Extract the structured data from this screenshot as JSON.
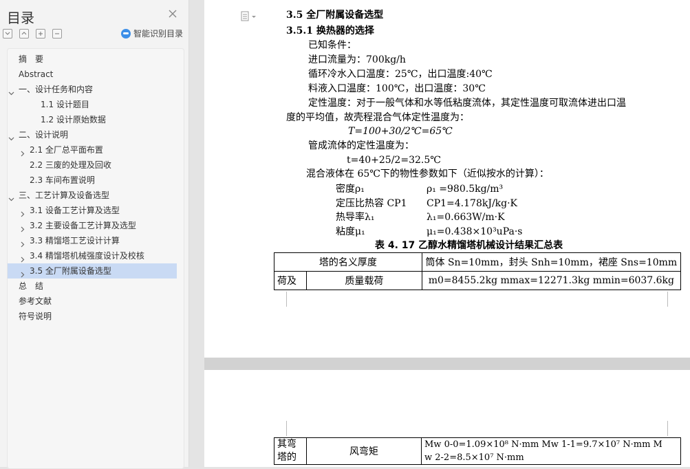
{
  "sidebar": {
    "title": "目录",
    "smart_toc_label": "智能识别目录",
    "items": [
      {
        "label": "摘　要",
        "level": 0,
        "chevron": "none"
      },
      {
        "label": "Abstract",
        "level": 0,
        "chevron": "none"
      },
      {
        "label": "一、设计任务和内容",
        "level": 0,
        "chevron": "down"
      },
      {
        "label": "1.1  设计题目",
        "level": 2,
        "chevron": "none"
      },
      {
        "label": "1.2  设计原始数据",
        "level": 2,
        "chevron": "none"
      },
      {
        "label": "二、设计说明",
        "level": 0,
        "chevron": "down"
      },
      {
        "label": "2.1  全厂总平面布置",
        "level": 1,
        "chevron": "right"
      },
      {
        "label": "2.2  三废的处理及回收",
        "level": 1,
        "chevron": "none"
      },
      {
        "label": "2.3  车间布置说明",
        "level": 1,
        "chevron": "none"
      },
      {
        "label": "三、工艺计算及设备选型",
        "level": 0,
        "chevron": "down"
      },
      {
        "label": "3.1  设备工艺计算及选型",
        "level": 1,
        "chevron": "right"
      },
      {
        "label": "3.2  主要设备工艺计算及选型",
        "level": 1,
        "chevron": "right"
      },
      {
        "label": "3.3  精馏塔工艺设计计算",
        "level": 1,
        "chevron": "right"
      },
      {
        "label": "3.4  精馏塔机械强度设计及校核",
        "level": 1,
        "chevron": "right"
      },
      {
        "label": "3.5  全厂附属设备选型",
        "level": 1,
        "chevron": "right",
        "active": true
      },
      {
        "label": "总　结",
        "level": 0,
        "chevron": "none"
      },
      {
        "label": "参考文献",
        "level": 0,
        "chevron": "none"
      },
      {
        "label": "符号说明",
        "level": 0,
        "chevron": "none"
      }
    ]
  },
  "doc": {
    "h1": "3.5  全厂附属设备选型",
    "h2": "3.5.1  换热器的选择",
    "known": "已知条件：",
    "flow": "进口流量为：700kg/h",
    "cooling": "循环冷水入口温度：25℃，出口温度:40℃",
    "feed": "料液入口温度：100℃，出口温度：30℃",
    "para1a": "定性温度：对于一般气体和水等低粘度流体，其定性温度可取流体进出口温",
    "para1b": "度的平均值，故壳程混合气体定性温度为：",
    "eqT": "T=100+30/2℃=65℃",
    "tube": "管成流体的定性温度为：",
    "eqt": "t=40+25/2=32.5℃",
    "mix": "混合液体在 65℃下的物性参数如下（近似按水的计算）：",
    "props": [
      {
        "name": "密度ρ₁",
        "value": "ρ₁ =980.5kg/m³"
      },
      {
        "name": "定压比热容 CP1",
        "value": "CP1=4.178kJ/kg·K"
      },
      {
        "name": "热导率λ₁",
        "value": "λ₁=0.663W/m·K"
      },
      {
        "name": "粘度μ₁",
        "value": "μ₁=0.438×10³uPa·s"
      }
    ],
    "caption": "表 4. 17  乙醇水精馏塔机械设计结果汇总表",
    "table1": {
      "r1_label": "塔的名义厚度",
      "r1_value": "筒体 Sn=10mm，封头 Snh=10mm，裙座 Sns=10mm",
      "r2_left": "荷及",
      "r2_label": "质量载荷",
      "r2_value": "m0=8455.2kg    mmax=12271.3kg    mmin=6037.6kg"
    },
    "table2": {
      "left1": "其弯",
      "left2": "塔的",
      "label": "风弯矩",
      "line1": "Mw 0-0=1.09×10⁸ N·mm      Mw 1-1=9.7×10⁷ N·mm      M",
      "line2": "w 2-2=8.5×10⁷ N·mm"
    }
  }
}
